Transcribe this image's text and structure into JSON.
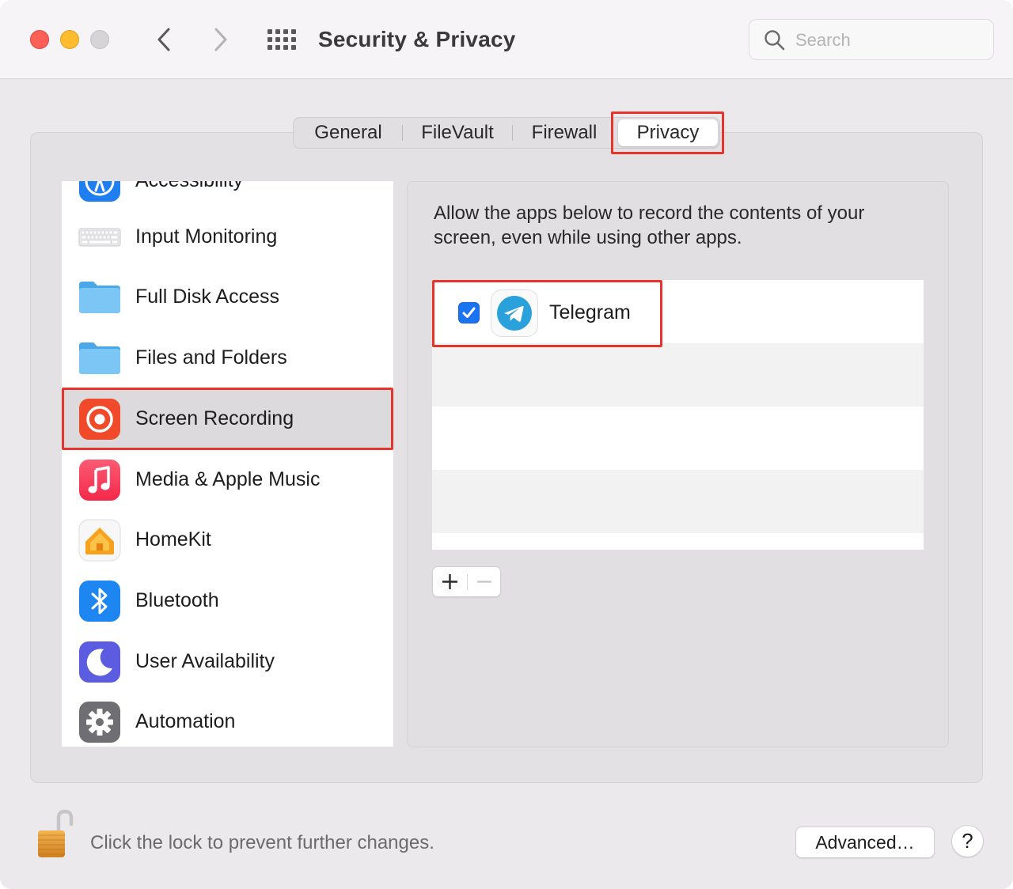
{
  "window": {
    "title": "Security & Privacy"
  },
  "search": {
    "placeholder": "Search",
    "value": ""
  },
  "tabs": [
    {
      "label": "General",
      "selected": false
    },
    {
      "label": "FileVault",
      "selected": false
    },
    {
      "label": "Firewall",
      "selected": false
    },
    {
      "label": "Privacy",
      "selected": true
    }
  ],
  "sidebar": {
    "items": [
      {
        "label": "Accessibility",
        "icon": "accessibility-icon",
        "selected": false
      },
      {
        "label": "Input Monitoring",
        "icon": "keyboard-icon",
        "selected": false
      },
      {
        "label": "Full Disk Access",
        "icon": "folder-icon",
        "selected": false
      },
      {
        "label": "Files and Folders",
        "icon": "folder-icon",
        "selected": false
      },
      {
        "label": "Screen Recording",
        "icon": "screen-recording-icon",
        "selected": true
      },
      {
        "label": "Media & Apple Music",
        "icon": "music-icon",
        "selected": false
      },
      {
        "label": "HomeKit",
        "icon": "home-icon",
        "selected": false
      },
      {
        "label": "Bluetooth",
        "icon": "bluetooth-icon",
        "selected": false
      },
      {
        "label": "User Availability",
        "icon": "moon-icon",
        "selected": false
      },
      {
        "label": "Automation",
        "icon": "gear-icon",
        "selected": false
      }
    ]
  },
  "main": {
    "description": "Allow the apps below to record the contents of your screen, even while using other apps.",
    "apps": [
      {
        "name": "Telegram",
        "icon": "telegram-icon",
        "checked": true
      }
    ]
  },
  "footer": {
    "lock_text": "Click the lock to prevent further changes.",
    "advanced_label": "Advanced…",
    "help_label": "?"
  },
  "colors": {
    "accent": "#1a73f0",
    "highlight": "#e8352c",
    "screen_recording": "#f04a2a",
    "telegram": "#2aa1da"
  }
}
